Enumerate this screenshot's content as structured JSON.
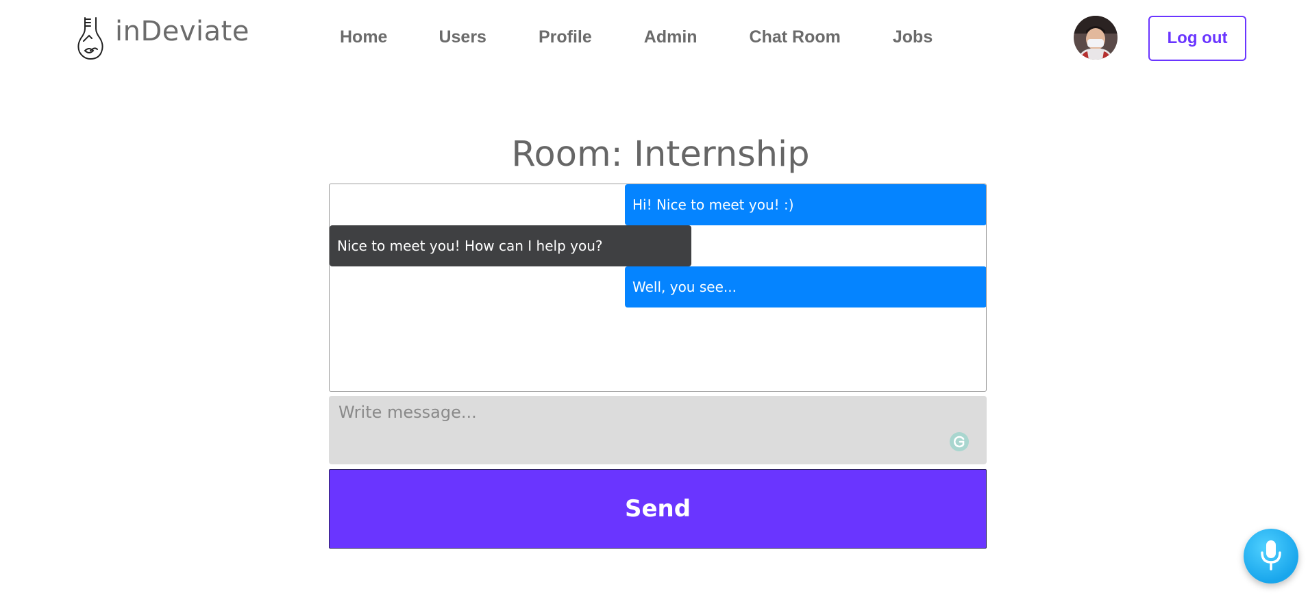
{
  "brand": {
    "name": "inDeviate",
    "logo_icon": "lightbulb-icon"
  },
  "nav": {
    "items": [
      {
        "label": "Home"
      },
      {
        "label": "Users"
      },
      {
        "label": "Profile"
      },
      {
        "label": "Admin"
      },
      {
        "label": "Chat Room"
      },
      {
        "label": "Jobs"
      }
    ]
  },
  "header": {
    "avatar_icon": "user-avatar",
    "logout_label": "Log out"
  },
  "room": {
    "title": "Room: Internship"
  },
  "messages": [
    {
      "text": "Hi! Nice to meet you! :)",
      "side": "self"
    },
    {
      "text": "Nice to meet you! How can I help you?",
      "side": "other"
    },
    {
      "text": "Well, you see...",
      "side": "self"
    }
  ],
  "composer": {
    "placeholder": "Write message...",
    "value": ""
  },
  "send_label": "Send",
  "mic_icon": "microphone-icon",
  "colors": {
    "accent": "#6a35ff",
    "self_bubble": "#0584ff",
    "other_bubble": "#3f4042",
    "input_bg": "#dcdcdc",
    "mic": "#19a6ec"
  }
}
